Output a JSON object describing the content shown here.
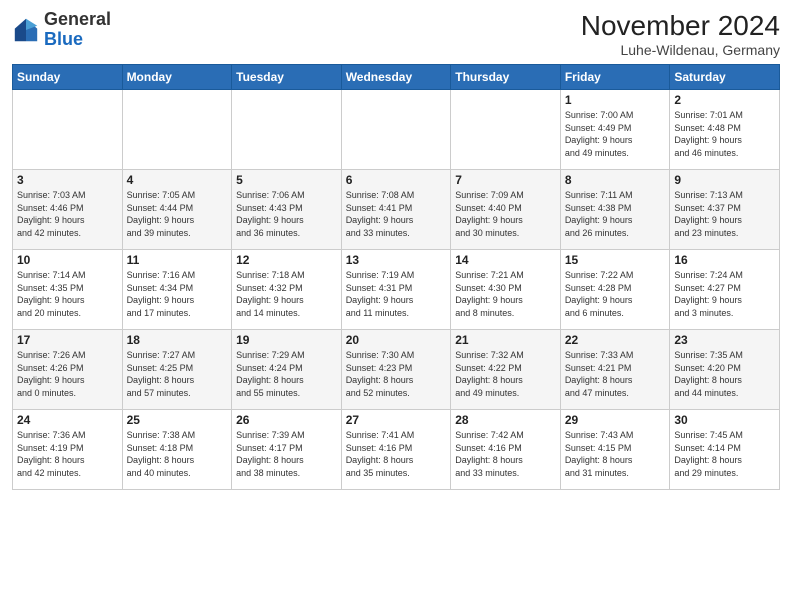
{
  "header": {
    "logo_general": "General",
    "logo_blue": "Blue",
    "month_title": "November 2024",
    "subtitle": "Luhe-Wildenau, Germany"
  },
  "weekdays": [
    "Sunday",
    "Monday",
    "Tuesday",
    "Wednesday",
    "Thursday",
    "Friday",
    "Saturday"
  ],
  "weeks": [
    [
      {
        "day": "",
        "detail": ""
      },
      {
        "day": "",
        "detail": ""
      },
      {
        "day": "",
        "detail": ""
      },
      {
        "day": "",
        "detail": ""
      },
      {
        "day": "",
        "detail": ""
      },
      {
        "day": "1",
        "detail": "Sunrise: 7:00 AM\nSunset: 4:49 PM\nDaylight: 9 hours\nand 49 minutes."
      },
      {
        "day": "2",
        "detail": "Sunrise: 7:01 AM\nSunset: 4:48 PM\nDaylight: 9 hours\nand 46 minutes."
      }
    ],
    [
      {
        "day": "3",
        "detail": "Sunrise: 7:03 AM\nSunset: 4:46 PM\nDaylight: 9 hours\nand 42 minutes."
      },
      {
        "day": "4",
        "detail": "Sunrise: 7:05 AM\nSunset: 4:44 PM\nDaylight: 9 hours\nand 39 minutes."
      },
      {
        "day": "5",
        "detail": "Sunrise: 7:06 AM\nSunset: 4:43 PM\nDaylight: 9 hours\nand 36 minutes."
      },
      {
        "day": "6",
        "detail": "Sunrise: 7:08 AM\nSunset: 4:41 PM\nDaylight: 9 hours\nand 33 minutes."
      },
      {
        "day": "7",
        "detail": "Sunrise: 7:09 AM\nSunset: 4:40 PM\nDaylight: 9 hours\nand 30 minutes."
      },
      {
        "day": "8",
        "detail": "Sunrise: 7:11 AM\nSunset: 4:38 PM\nDaylight: 9 hours\nand 26 minutes."
      },
      {
        "day": "9",
        "detail": "Sunrise: 7:13 AM\nSunset: 4:37 PM\nDaylight: 9 hours\nand 23 minutes."
      }
    ],
    [
      {
        "day": "10",
        "detail": "Sunrise: 7:14 AM\nSunset: 4:35 PM\nDaylight: 9 hours\nand 20 minutes."
      },
      {
        "day": "11",
        "detail": "Sunrise: 7:16 AM\nSunset: 4:34 PM\nDaylight: 9 hours\nand 17 minutes."
      },
      {
        "day": "12",
        "detail": "Sunrise: 7:18 AM\nSunset: 4:32 PM\nDaylight: 9 hours\nand 14 minutes."
      },
      {
        "day": "13",
        "detail": "Sunrise: 7:19 AM\nSunset: 4:31 PM\nDaylight: 9 hours\nand 11 minutes."
      },
      {
        "day": "14",
        "detail": "Sunrise: 7:21 AM\nSunset: 4:30 PM\nDaylight: 9 hours\nand 8 minutes."
      },
      {
        "day": "15",
        "detail": "Sunrise: 7:22 AM\nSunset: 4:28 PM\nDaylight: 9 hours\nand 6 minutes."
      },
      {
        "day": "16",
        "detail": "Sunrise: 7:24 AM\nSunset: 4:27 PM\nDaylight: 9 hours\nand 3 minutes."
      }
    ],
    [
      {
        "day": "17",
        "detail": "Sunrise: 7:26 AM\nSunset: 4:26 PM\nDaylight: 9 hours\nand 0 minutes."
      },
      {
        "day": "18",
        "detail": "Sunrise: 7:27 AM\nSunset: 4:25 PM\nDaylight: 8 hours\nand 57 minutes."
      },
      {
        "day": "19",
        "detail": "Sunrise: 7:29 AM\nSunset: 4:24 PM\nDaylight: 8 hours\nand 55 minutes."
      },
      {
        "day": "20",
        "detail": "Sunrise: 7:30 AM\nSunset: 4:23 PM\nDaylight: 8 hours\nand 52 minutes."
      },
      {
        "day": "21",
        "detail": "Sunrise: 7:32 AM\nSunset: 4:22 PM\nDaylight: 8 hours\nand 49 minutes."
      },
      {
        "day": "22",
        "detail": "Sunrise: 7:33 AM\nSunset: 4:21 PM\nDaylight: 8 hours\nand 47 minutes."
      },
      {
        "day": "23",
        "detail": "Sunrise: 7:35 AM\nSunset: 4:20 PM\nDaylight: 8 hours\nand 44 minutes."
      }
    ],
    [
      {
        "day": "24",
        "detail": "Sunrise: 7:36 AM\nSunset: 4:19 PM\nDaylight: 8 hours\nand 42 minutes."
      },
      {
        "day": "25",
        "detail": "Sunrise: 7:38 AM\nSunset: 4:18 PM\nDaylight: 8 hours\nand 40 minutes."
      },
      {
        "day": "26",
        "detail": "Sunrise: 7:39 AM\nSunset: 4:17 PM\nDaylight: 8 hours\nand 38 minutes."
      },
      {
        "day": "27",
        "detail": "Sunrise: 7:41 AM\nSunset: 4:16 PM\nDaylight: 8 hours\nand 35 minutes."
      },
      {
        "day": "28",
        "detail": "Sunrise: 7:42 AM\nSunset: 4:16 PM\nDaylight: 8 hours\nand 33 minutes."
      },
      {
        "day": "29",
        "detail": "Sunrise: 7:43 AM\nSunset: 4:15 PM\nDaylight: 8 hours\nand 31 minutes."
      },
      {
        "day": "30",
        "detail": "Sunrise: 7:45 AM\nSunset: 4:14 PM\nDaylight: 8 hours\nand 29 minutes."
      }
    ]
  ]
}
